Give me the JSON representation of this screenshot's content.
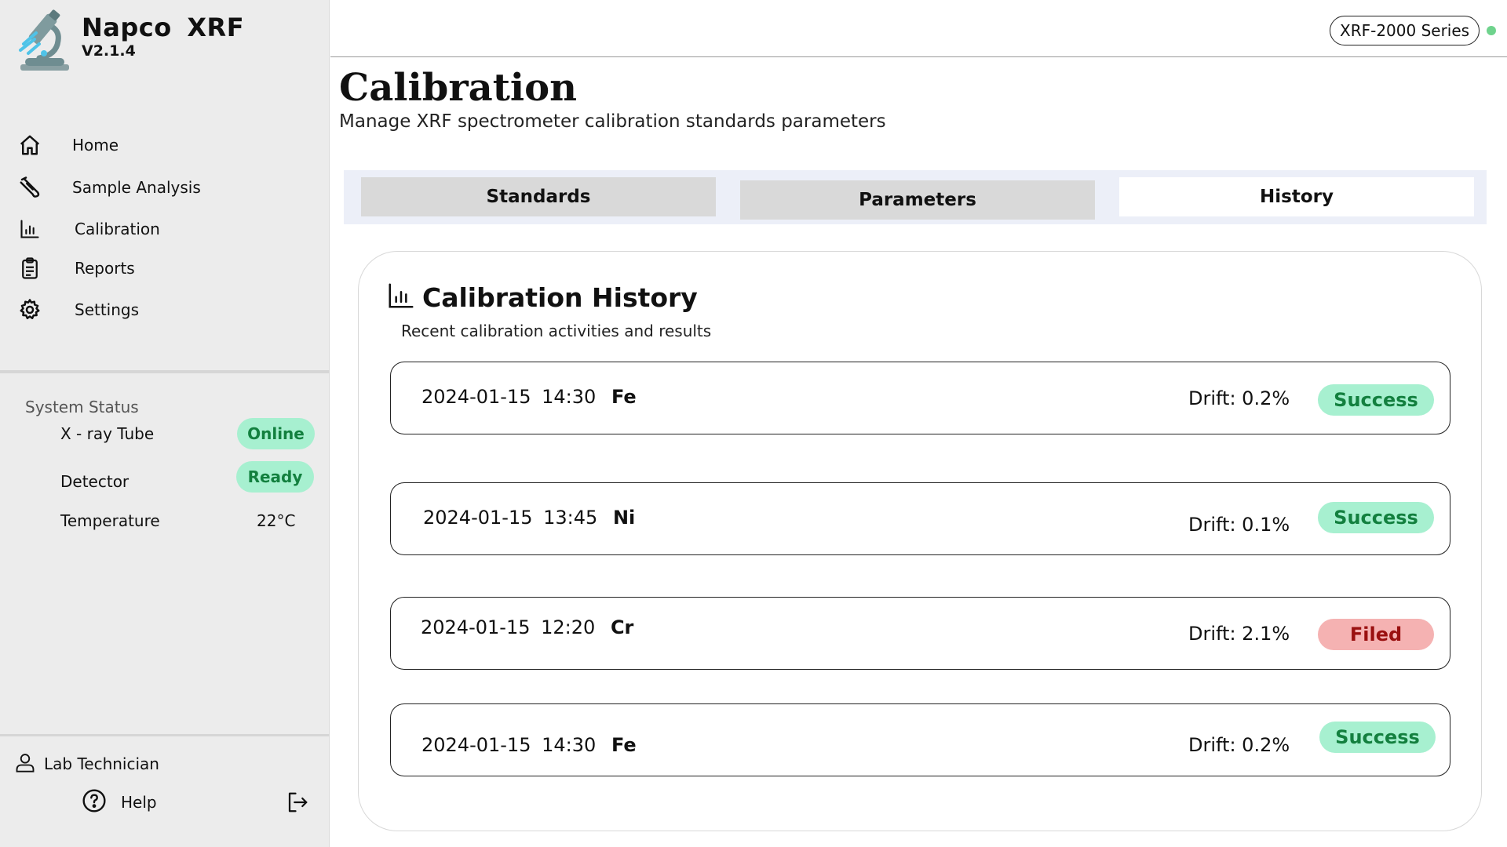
{
  "app": {
    "name": "Napco  XRF",
    "version": "V2.1.4"
  },
  "nav": {
    "items": [
      {
        "label": "Home",
        "icon": "home-icon"
      },
      {
        "label": "Sample Analysis",
        "icon": "test-tube-icon"
      },
      {
        "label": "Calibration",
        "icon": "bar-chart-icon"
      },
      {
        "label": "Reports",
        "icon": "clipboard-icon"
      },
      {
        "label": "Settings",
        "icon": "gear-icon"
      }
    ]
  },
  "system_status": {
    "title": "System Status",
    "items": [
      {
        "label": "X - ray Tube",
        "value": "Online"
      },
      {
        "label": "Detector",
        "value": "Ready"
      },
      {
        "label": "Temperature",
        "value": "22°C"
      }
    ]
  },
  "user": {
    "role": "Lab Technician",
    "help_label": "Help"
  },
  "header": {
    "device": "XRF-2000 Series",
    "status_color": "#6fd38d"
  },
  "page": {
    "title": "Calibration",
    "subtitle": "Manage XRF spectrometer calibration standards parameters"
  },
  "tabs": [
    {
      "label": "Standards",
      "active": false
    },
    {
      "label": "Parameters",
      "active": false
    },
    {
      "label": "History",
      "active": true
    }
  ],
  "history": {
    "title": "Calibration History",
    "subtitle": "Recent calibration activities and results",
    "entries": [
      {
        "date": "2024-01-15",
        "time": "14:30",
        "element": "Fe",
        "drift": "Drift: 0.2%",
        "result": "Success"
      },
      {
        "date": "2024-01-15",
        "time": "13:45",
        "element": "Ni",
        "drift": "Drift: 0.1%",
        "result": "Success"
      },
      {
        "date": "2024-01-15",
        "time": "12:20",
        "element": "Cr",
        "drift": "Drift: 2.1%",
        "result": "Filed"
      },
      {
        "date": "2024-01-15",
        "time": "14:30",
        "element": "Fe",
        "drift": "Drift: 0.2%",
        "result": "Success"
      }
    ]
  },
  "colors": {
    "success_bg": "#a7f0d0",
    "success_text": "#13803f",
    "fail_bg": "#f5b2b2",
    "fail_text": "#9a1010",
    "tab_strip": "#eceff8"
  }
}
